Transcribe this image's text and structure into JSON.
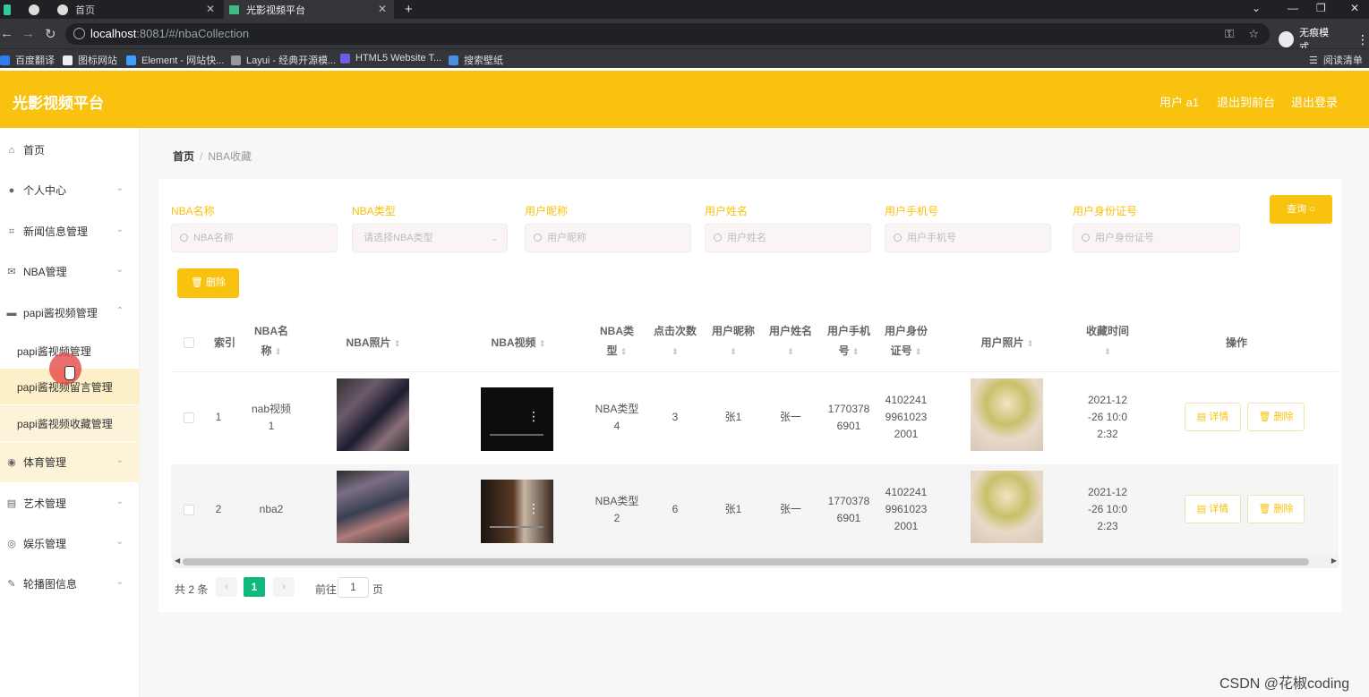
{
  "browser": {
    "tabs": [
      {
        "title": "首页"
      },
      {
        "title": "光影视频平台"
      }
    ],
    "url_host": "localhost",
    "url_path": ":8081/#/nbaCollection",
    "incognito_label": "无痕模式",
    "bookmarks": [
      "百度翻译",
      "图标网站",
      "Element - 网站快...",
      "Layui - 经典开源模...",
      "HTML5 Website T...",
      "搜索壁纸"
    ],
    "reading_list": "阅读清单"
  },
  "header": {
    "brand": "光影视频平台",
    "user": "用户 a1",
    "front": "退出到前台",
    "logout": "退出登录"
  },
  "sidebar": {
    "items": [
      {
        "label": "首页",
        "icon": "home-icon"
      },
      {
        "label": "个人中心",
        "icon": "user-icon"
      },
      {
        "label": "新闻信息管理",
        "icon": "crop-icon"
      },
      {
        "label": "NBA管理",
        "icon": "mail-icon"
      },
      {
        "label": "papi酱视频管理",
        "icon": "folder-icon"
      },
      {
        "label": "体育管理",
        "icon": "pin-icon"
      },
      {
        "label": "艺术管理",
        "icon": "doc-icon"
      },
      {
        "label": "娱乐管理",
        "icon": "globe-icon"
      },
      {
        "label": "轮播图信息",
        "icon": "pen-icon"
      }
    ],
    "sub_items": [
      "papi酱视频管理",
      "papi酱视频留言管理",
      "papi酱视频收藏管理"
    ]
  },
  "breadcrumb": {
    "home": "首页",
    "sep": "/",
    "current": "NBA收藏"
  },
  "filters": [
    {
      "label": "NBA名称",
      "placeholder": "NBA名称"
    },
    {
      "label": "NBA类型",
      "placeholder": "请选择NBA类型"
    },
    {
      "label": "用户昵称",
      "placeholder": "用户昵称"
    },
    {
      "label": "用户姓名",
      "placeholder": "用户姓名"
    },
    {
      "label": "用户手机号",
      "placeholder": "用户手机号"
    },
    {
      "label": "用户身份证号",
      "placeholder": "用户身份证号"
    }
  ],
  "buttons": {
    "query": "查询",
    "delete": "删除",
    "detail": "详情",
    "row_delete": "删除"
  },
  "table": {
    "headers": {
      "index": "索引",
      "name_1": "NBA名",
      "name_2": "称",
      "photo": "NBA照片",
      "video": "NBA视频",
      "type_1": "NBA类",
      "type_2": "型",
      "clicks": "点击次数",
      "nickname": "用户昵称",
      "realname": "用户姓名",
      "phone_1": "用户手机",
      "phone_2": "号",
      "idcard_1": "用户身份",
      "idcard_2": "证号",
      "userphoto": "用户照片",
      "time": "收藏时间",
      "ops": "操作"
    },
    "rows": [
      {
        "index": "1",
        "name_1": "nab视频",
        "name_2": "1",
        "type_1": "NBA类型",
        "type_2": "4",
        "clicks": "3",
        "nickname": "张1",
        "realname": "张一",
        "phone_1": "1770378",
        "phone_2": "6901",
        "id_1": "4102241",
        "id_2": "9961023",
        "id_3": "2001",
        "time_1": "2021-12",
        "time_2": "-26 10:0",
        "time_3": "2:32"
      },
      {
        "index": "2",
        "name_1": "nba2",
        "name_2": "",
        "type_1": "NBA类型",
        "type_2": "2",
        "clicks": "6",
        "nickname": "张1",
        "realname": "张一",
        "phone_1": "1770378",
        "phone_2": "6901",
        "id_1": "4102241",
        "id_2": "9961023",
        "id_3": "2001",
        "time_1": "2021-12",
        "time_2": "-26 10:0",
        "time_3": "2:23"
      }
    ]
  },
  "pagination": {
    "total": "共 2 条",
    "current": "1",
    "goto": "前往",
    "page_value": "1",
    "page_unit": "页"
  },
  "watermark": "CSDN @花椒coding",
  "colors": {
    "accent": "#f8c20e",
    "page_active": "#0fb97c"
  }
}
